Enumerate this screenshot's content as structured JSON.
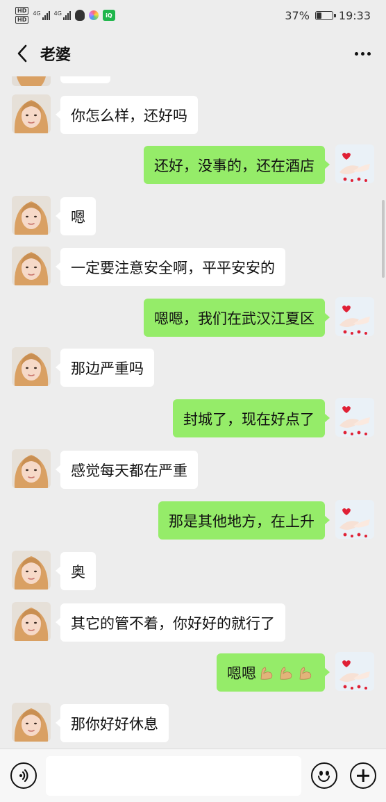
{
  "status_bar": {
    "hd_top": "HD",
    "hd_bottom": "HD",
    "sim1_net": "4G",
    "sim2_net": "4G",
    "app_icons": [
      "qq-icon",
      "photo-icon",
      "iqiyi-icon"
    ],
    "iqiyi_label": "iQIYI",
    "battery_level": 0.37,
    "battery_text": "37%",
    "time": "19:33"
  },
  "header": {
    "back_icon": "chevron-left-icon",
    "title": "老婆",
    "more_icon": "ellipsis-icon"
  },
  "contacts": {
    "incoming_avatar": "woman-selfie-avatar",
    "outgoing_avatar": "holding-hands-hearts-avatar"
  },
  "messages": [
    {
      "side": "in",
      "text": "你怎么样，还好吗"
    },
    {
      "side": "out",
      "text": "还好，没事的，还在酒店"
    },
    {
      "side": "in",
      "text": "嗯"
    },
    {
      "side": "in",
      "text": "一定要注意安全啊，平平安安的"
    },
    {
      "side": "out",
      "text": "嗯嗯，我们在武汉江夏区"
    },
    {
      "side": "in",
      "text": "那边严重吗"
    },
    {
      "side": "out",
      "text": "封城了，现在好点了"
    },
    {
      "side": "in",
      "text": "感觉每天都在严重"
    },
    {
      "side": "out",
      "text": "那是其他地方，在上升"
    },
    {
      "side": "in",
      "text": "奥"
    },
    {
      "side": "in",
      "text": "其它的管不着，你好好的就行了"
    },
    {
      "side": "out",
      "text": "嗯嗯",
      "emoji": "flexed-biceps-icon",
      "emoji_count": 3
    },
    {
      "side": "in",
      "text": "那你好好休息"
    }
  ],
  "input_bar": {
    "voice_icon": "voice-wave-icon",
    "input_value": "",
    "emoji_icon": "smiley-icon",
    "plus_icon": "plus-icon"
  },
  "colors": {
    "background": "#ededed",
    "incoming_bubble": "#ffffff",
    "outgoing_bubble": "#95ec69",
    "text": "#111111"
  }
}
